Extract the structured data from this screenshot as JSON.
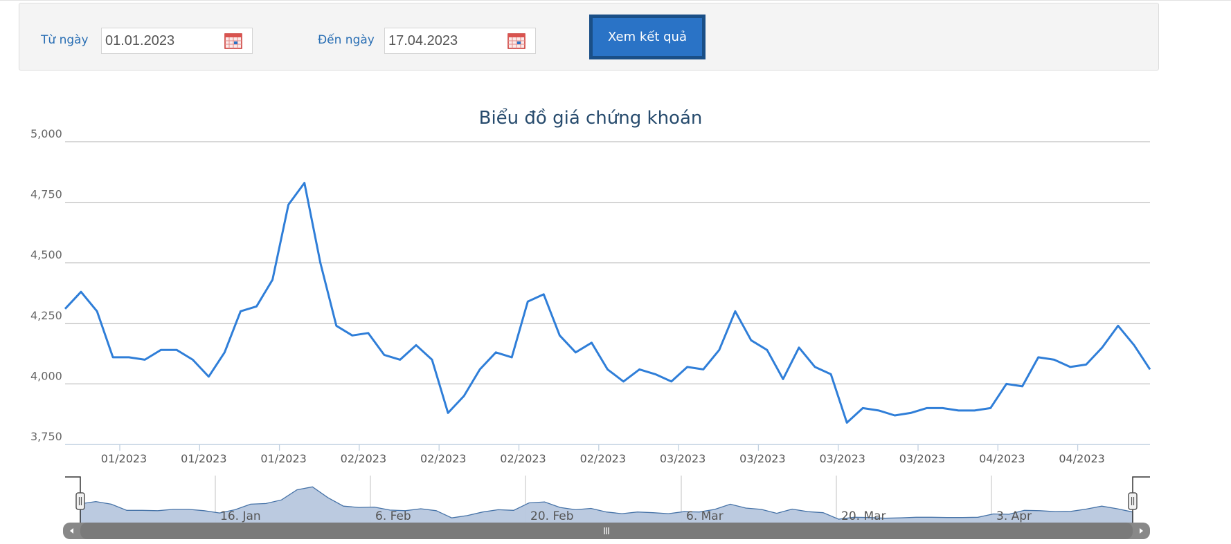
{
  "filter": {
    "from_label": "Từ ngày",
    "from_value": "01.01.2023",
    "to_label": "Đến ngày",
    "to_value": "17.04.2023",
    "submit_label": "Xem kết quả"
  },
  "colors": {
    "line": "#2f7ed8",
    "label_blue": "#2a6fb4",
    "button": "#2a73c6",
    "button_border": "#1a4f87",
    "title": "#274b6d",
    "navigator_fill": "#b7c7de",
    "navigator_line": "#4572a7",
    "scrollbar": "#888888"
  },
  "icons": {
    "calendar": "calendar-icon"
  },
  "chart_data": {
    "type": "line",
    "title": "Biểu đồ giá chứng khoán",
    "xlabel": "",
    "ylabel": "",
    "ylim": [
      3750,
      5000
    ],
    "yticks": [
      "3,750",
      "4,000",
      "4,250",
      "4,500",
      "4,750",
      "5,000"
    ],
    "xticks": [
      "01/2023",
      "01/2023",
      "01/2023",
      "02/2023",
      "02/2023",
      "02/2023",
      "02/2023",
      "03/2023",
      "03/2023",
      "03/2023",
      "03/2023",
      "04/2023",
      "04/2023"
    ],
    "grid": true,
    "legend": "none",
    "series": [
      {
        "values": [
          4310,
          4380,
          4300,
          4110,
          4110,
          4100,
          4140,
          4140,
          4100,
          4030,
          4130,
          4300,
          4320,
          4430,
          4740,
          4830,
          4500,
          4240,
          4200,
          4210,
          4120,
          4100,
          4160,
          4100,
          3880,
          3950,
          4060,
          4130,
          4110,
          4340,
          4370,
          4200,
          4130,
          4170,
          4060,
          4010,
          4060,
          4040,
          4010,
          4070,
          4060,
          4140,
          4300,
          4180,
          4140,
          4020,
          4150,
          4070,
          4040,
          3840,
          3900,
          3890,
          3870,
          3880,
          3900,
          3900,
          3890,
          3890,
          3900,
          4000,
          3990,
          4110,
          4100,
          4070,
          4080,
          4150,
          4240,
          4160,
          4060
        ]
      }
    ],
    "navigator": {
      "labels": [
        "16. Jan",
        "6. Feb",
        "20. Feb",
        "6. Mar",
        "20. Mar",
        "3. Apr"
      ]
    }
  }
}
